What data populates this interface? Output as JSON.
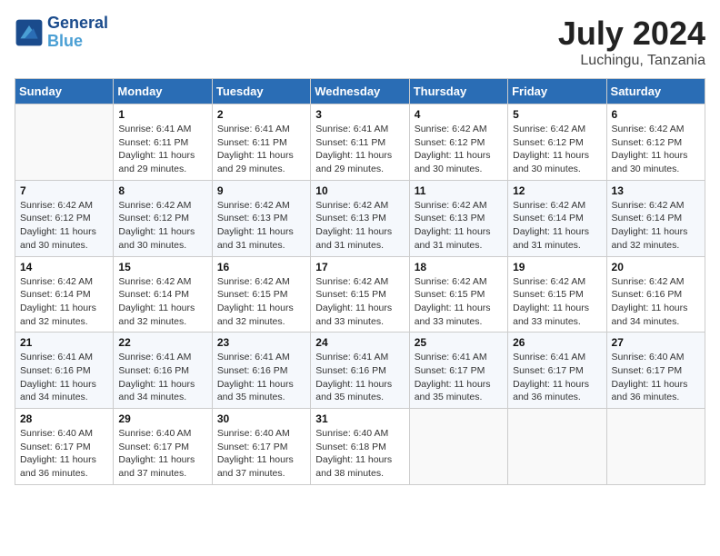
{
  "logo": {
    "line1": "General",
    "line2": "Blue"
  },
  "title": "July 2024",
  "location": "Luchingu, Tanzania",
  "days_of_week": [
    "Sunday",
    "Monday",
    "Tuesday",
    "Wednesday",
    "Thursday",
    "Friday",
    "Saturday"
  ],
  "weeks": [
    [
      {
        "day": "",
        "sunrise": "",
        "sunset": "",
        "daylight": ""
      },
      {
        "day": "1",
        "sunrise": "Sunrise: 6:41 AM",
        "sunset": "Sunset: 6:11 PM",
        "daylight": "Daylight: 11 hours and 29 minutes."
      },
      {
        "day": "2",
        "sunrise": "Sunrise: 6:41 AM",
        "sunset": "Sunset: 6:11 PM",
        "daylight": "Daylight: 11 hours and 29 minutes."
      },
      {
        "day": "3",
        "sunrise": "Sunrise: 6:41 AM",
        "sunset": "Sunset: 6:11 PM",
        "daylight": "Daylight: 11 hours and 29 minutes."
      },
      {
        "day": "4",
        "sunrise": "Sunrise: 6:42 AM",
        "sunset": "Sunset: 6:12 PM",
        "daylight": "Daylight: 11 hours and 30 minutes."
      },
      {
        "day": "5",
        "sunrise": "Sunrise: 6:42 AM",
        "sunset": "Sunset: 6:12 PM",
        "daylight": "Daylight: 11 hours and 30 minutes."
      },
      {
        "day": "6",
        "sunrise": "Sunrise: 6:42 AM",
        "sunset": "Sunset: 6:12 PM",
        "daylight": "Daylight: 11 hours and 30 minutes."
      }
    ],
    [
      {
        "day": "7",
        "sunrise": "Sunrise: 6:42 AM",
        "sunset": "Sunset: 6:12 PM",
        "daylight": "Daylight: 11 hours and 30 minutes."
      },
      {
        "day": "8",
        "sunrise": "Sunrise: 6:42 AM",
        "sunset": "Sunset: 6:12 PM",
        "daylight": "Daylight: 11 hours and 30 minutes."
      },
      {
        "day": "9",
        "sunrise": "Sunrise: 6:42 AM",
        "sunset": "Sunset: 6:13 PM",
        "daylight": "Daylight: 11 hours and 31 minutes."
      },
      {
        "day": "10",
        "sunrise": "Sunrise: 6:42 AM",
        "sunset": "Sunset: 6:13 PM",
        "daylight": "Daylight: 11 hours and 31 minutes."
      },
      {
        "day": "11",
        "sunrise": "Sunrise: 6:42 AM",
        "sunset": "Sunset: 6:13 PM",
        "daylight": "Daylight: 11 hours and 31 minutes."
      },
      {
        "day": "12",
        "sunrise": "Sunrise: 6:42 AM",
        "sunset": "Sunset: 6:14 PM",
        "daylight": "Daylight: 11 hours and 31 minutes."
      },
      {
        "day": "13",
        "sunrise": "Sunrise: 6:42 AM",
        "sunset": "Sunset: 6:14 PM",
        "daylight": "Daylight: 11 hours and 32 minutes."
      }
    ],
    [
      {
        "day": "14",
        "sunrise": "Sunrise: 6:42 AM",
        "sunset": "Sunset: 6:14 PM",
        "daylight": "Daylight: 11 hours and 32 minutes."
      },
      {
        "day": "15",
        "sunrise": "Sunrise: 6:42 AM",
        "sunset": "Sunset: 6:14 PM",
        "daylight": "Daylight: 11 hours and 32 minutes."
      },
      {
        "day": "16",
        "sunrise": "Sunrise: 6:42 AM",
        "sunset": "Sunset: 6:15 PM",
        "daylight": "Daylight: 11 hours and 32 minutes."
      },
      {
        "day": "17",
        "sunrise": "Sunrise: 6:42 AM",
        "sunset": "Sunset: 6:15 PM",
        "daylight": "Daylight: 11 hours and 33 minutes."
      },
      {
        "day": "18",
        "sunrise": "Sunrise: 6:42 AM",
        "sunset": "Sunset: 6:15 PM",
        "daylight": "Daylight: 11 hours and 33 minutes."
      },
      {
        "day": "19",
        "sunrise": "Sunrise: 6:42 AM",
        "sunset": "Sunset: 6:15 PM",
        "daylight": "Daylight: 11 hours and 33 minutes."
      },
      {
        "day": "20",
        "sunrise": "Sunrise: 6:42 AM",
        "sunset": "Sunset: 6:16 PM",
        "daylight": "Daylight: 11 hours and 34 minutes."
      }
    ],
    [
      {
        "day": "21",
        "sunrise": "Sunrise: 6:41 AM",
        "sunset": "Sunset: 6:16 PM",
        "daylight": "Daylight: 11 hours and 34 minutes."
      },
      {
        "day": "22",
        "sunrise": "Sunrise: 6:41 AM",
        "sunset": "Sunset: 6:16 PM",
        "daylight": "Daylight: 11 hours and 34 minutes."
      },
      {
        "day": "23",
        "sunrise": "Sunrise: 6:41 AM",
        "sunset": "Sunset: 6:16 PM",
        "daylight": "Daylight: 11 hours and 35 minutes."
      },
      {
        "day": "24",
        "sunrise": "Sunrise: 6:41 AM",
        "sunset": "Sunset: 6:16 PM",
        "daylight": "Daylight: 11 hours and 35 minutes."
      },
      {
        "day": "25",
        "sunrise": "Sunrise: 6:41 AM",
        "sunset": "Sunset: 6:17 PM",
        "daylight": "Daylight: 11 hours and 35 minutes."
      },
      {
        "day": "26",
        "sunrise": "Sunrise: 6:41 AM",
        "sunset": "Sunset: 6:17 PM",
        "daylight": "Daylight: 11 hours and 36 minutes."
      },
      {
        "day": "27",
        "sunrise": "Sunrise: 6:40 AM",
        "sunset": "Sunset: 6:17 PM",
        "daylight": "Daylight: 11 hours and 36 minutes."
      }
    ],
    [
      {
        "day": "28",
        "sunrise": "Sunrise: 6:40 AM",
        "sunset": "Sunset: 6:17 PM",
        "daylight": "Daylight: 11 hours and 36 minutes."
      },
      {
        "day": "29",
        "sunrise": "Sunrise: 6:40 AM",
        "sunset": "Sunset: 6:17 PM",
        "daylight": "Daylight: 11 hours and 37 minutes."
      },
      {
        "day": "30",
        "sunrise": "Sunrise: 6:40 AM",
        "sunset": "Sunset: 6:17 PM",
        "daylight": "Daylight: 11 hours and 37 minutes."
      },
      {
        "day": "31",
        "sunrise": "Sunrise: 6:40 AM",
        "sunset": "Sunset: 6:18 PM",
        "daylight": "Daylight: 11 hours and 38 minutes."
      },
      {
        "day": "",
        "sunrise": "",
        "sunset": "",
        "daylight": ""
      },
      {
        "day": "",
        "sunrise": "",
        "sunset": "",
        "daylight": ""
      },
      {
        "day": "",
        "sunrise": "",
        "sunset": "",
        "daylight": ""
      }
    ]
  ]
}
